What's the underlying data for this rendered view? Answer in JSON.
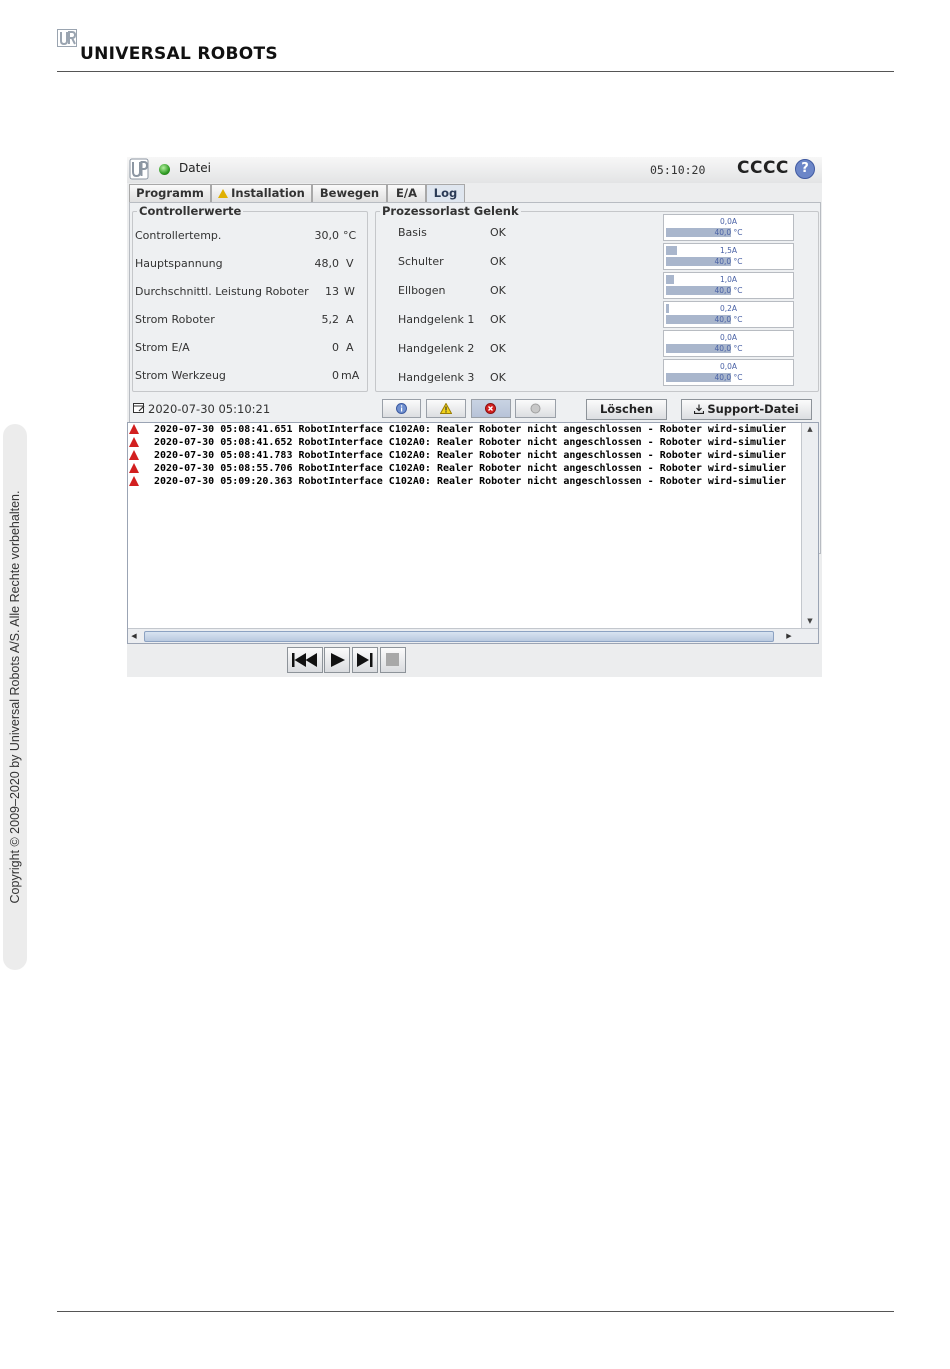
{
  "document": {
    "brand": "UNIVERSAL ROBOTS",
    "copyright": "Copyright © 2009–2020 by Universal Robots A/S. Alle Rechte vorbehalten."
  },
  "app": {
    "menu_label": "Datei",
    "clock": "05:10:20",
    "robot_name": "CCCC",
    "help_label": "?",
    "status_color": "#2e9a22",
    "tabs": [
      {
        "label": "Programm",
        "active": false
      },
      {
        "label": "Installation",
        "active": false,
        "warning": true
      },
      {
        "label": "Bewegen",
        "active": false
      },
      {
        "label": "E/A",
        "active": false
      },
      {
        "label": "Log",
        "active": true
      }
    ]
  },
  "controller": {
    "title": "Controllerwerte",
    "rows": [
      {
        "label": "Controllertemp.",
        "value": "30,0",
        "unit": "°C"
      },
      {
        "label": "Hauptspannung",
        "value": "48,0",
        "unit": "V"
      },
      {
        "label": "Durchschnittl. Leistung Roboter",
        "value": "13",
        "unit": "W"
      },
      {
        "label": "Strom Roboter",
        "value": "5,2",
        "unit": "A"
      },
      {
        "label": "Strom E/A",
        "value": "0",
        "unit": "A"
      },
      {
        "label": "Strom Werkzeug",
        "value": "0",
        "unit": "mA"
      }
    ]
  },
  "joints": {
    "title": "Prozessorlast Gelenk",
    "rows": [
      {
        "label": "Basis",
        "status": "OK",
        "current": "0,0A",
        "current_fraction": 0.0,
        "temp": "40,0 °C",
        "temp_fraction": 0.52
      },
      {
        "label": "Schulter",
        "status": "OK",
        "current": "1,5A",
        "current_fraction": 0.09,
        "temp": "40,0 °C",
        "temp_fraction": 0.52
      },
      {
        "label": "Ellbogen",
        "status": "OK",
        "current": "1,0A",
        "current_fraction": 0.06,
        "temp": "40,0 °C",
        "temp_fraction": 0.52
      },
      {
        "label": "Handgelenk 1",
        "status": "OK",
        "current": "0,2A",
        "current_fraction": 0.02,
        "temp": "40,0 °C",
        "temp_fraction": 0.52
      },
      {
        "label": "Handgelenk 2",
        "status": "OK",
        "current": "0,0A",
        "current_fraction": 0.0,
        "temp": "40,0 °C",
        "temp_fraction": 0.52
      },
      {
        "label": "Handgelenk 3",
        "status": "OK",
        "current": "0,0A",
        "current_fraction": 0.0,
        "temp": "40,0 °C",
        "temp_fraction": 0.52
      }
    ]
  },
  "log": {
    "date": "2020-07-30 05:10:21",
    "clear_label": "Löschen",
    "support_label": "Support-Datei",
    "filters": [
      {
        "icon": "info-icon",
        "pressed": false
      },
      {
        "icon": "warning-icon",
        "pressed": false
      },
      {
        "icon": "error-icon",
        "pressed": true
      },
      {
        "icon": "debug-icon",
        "pressed": false
      }
    ],
    "entries": [
      {
        "text": "2020-07-30 05:08:41.651 RobotInterface  C102A0: Realer Roboter nicht angeschlossen - Roboter wird-simulier"
      },
      {
        "text": "2020-07-30 05:08:41.652 RobotInterface  C102A0: Realer Roboter nicht angeschlossen - Roboter wird-simulier"
      },
      {
        "text": "2020-07-30 05:08:41.783 RobotInterface  C102A0: Realer Roboter nicht angeschlossen - Roboter wird-simulier"
      },
      {
        "text": "2020-07-30 05:08:55.706 RobotInterface  C102A0: Realer Roboter nicht angeschlossen - Roboter wird-simulier"
      },
      {
        "text": "2020-07-30 05:09:20.363 RobotInterface  C102A0: Realer Roboter nicht angeschlossen - Roboter wird-simulier"
      }
    ]
  },
  "player": {
    "buttons": [
      "rewind-icon",
      "play-icon",
      "step-icon",
      "stop-icon"
    ]
  }
}
